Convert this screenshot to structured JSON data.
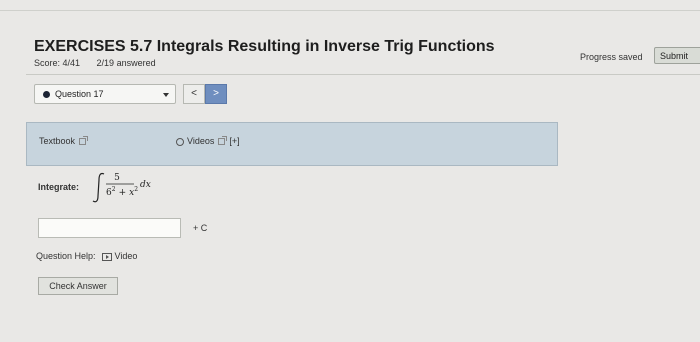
{
  "header": {
    "title": "EXERCISES 5.7 Integrals Resulting in Inverse Trig Functions",
    "score": "Score: 4/41",
    "answered": "2/19 answered",
    "progress_status": "Progress saved",
    "submit_label": "Submit"
  },
  "question_nav": {
    "selected": "Question 17",
    "prev_label": "<",
    "next_label": ">"
  },
  "resources": {
    "textbook_label": "Textbook",
    "videos_label": "Videos",
    "expand_label": "[+]"
  },
  "problem": {
    "label": "Integrate:",
    "numerator": "5",
    "denominator_base": "6",
    "denominator_exp": "2",
    "denominator_plus": "+",
    "denominator_var": "x",
    "denominator_var_exp": "2",
    "differential": "dx",
    "answer_value": "",
    "constant": "+ C"
  },
  "help": {
    "label": "Question Help:",
    "video_label": "Video"
  },
  "actions": {
    "check_label": "Check Answer"
  }
}
